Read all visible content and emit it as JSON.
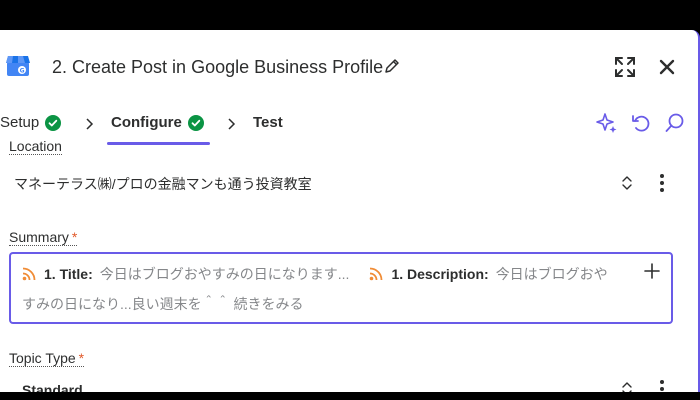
{
  "header": {
    "title": "2. Create Post in Google Business Profile",
    "app_icon": "google-business-profile-icon"
  },
  "tabs": [
    {
      "label": "Setup",
      "complete": true
    },
    {
      "label": "Configure",
      "complete": true,
      "active": true
    },
    {
      "label": "Test",
      "complete": false
    }
  ],
  "toolbar": {
    "icons": [
      "sparkle-icon",
      "undo-icon",
      "search-icon",
      "expand-icon",
      "close-icon"
    ]
  },
  "fields": {
    "location": {
      "label": "Location",
      "value": "マネーテラス㈱/プロの金融マンも通う投資教室"
    },
    "summary": {
      "label": "Summary",
      "required_mark": "*",
      "pill1_label": "1. Title:",
      "pill1_value": "今日はブログおやすみの日になります...",
      "pill2_label": "1. Description:",
      "pill2_value": "今日はブログおや",
      "line2": "すみの日になり...良い週末を＾＾ 続きをみる"
    },
    "topic_type": {
      "label": "Topic Type",
      "required_mark": "*",
      "value": "Standard"
    }
  },
  "colors": {
    "accent": "#695be8",
    "success": "#0b9444",
    "required": "#e1592a",
    "rss": "#f08c36"
  }
}
